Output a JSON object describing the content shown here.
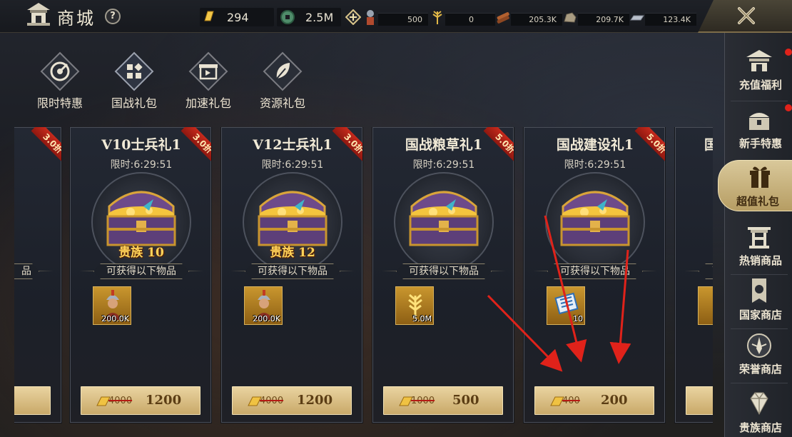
{
  "header": {
    "title": "商城",
    "help_label": "?",
    "gold": "294",
    "coins": "2.5M",
    "resources": [
      {
        "icon": "soldier-icon",
        "value": "500"
      },
      {
        "icon": "grain-icon",
        "value": "0"
      },
      {
        "icon": "wood-icon",
        "value": "205.3K"
      },
      {
        "icon": "stone-icon",
        "value": "209.7K"
      },
      {
        "icon": "iron-icon",
        "value": "123.4K"
      }
    ]
  },
  "categories": [
    {
      "label": "限时特惠"
    },
    {
      "label": "国战礼包"
    },
    {
      "label": "加速礼包"
    },
    {
      "label": "资源礼包"
    }
  ],
  "cards": [
    {
      "title": "V10士兵礼1",
      "discount": "3.0折",
      "timer": "限时:6:29:51",
      "nobility": "贵族 10",
      "obtain": "可获得以下物品",
      "item_icon": "soldier-icon",
      "item_qty": "200.0K",
      "old_price": "4000",
      "new_price": "1200"
    },
    {
      "title": "V12士兵礼1",
      "discount": "3.0折",
      "timer": "限时:6:29:51",
      "nobility": "贵族 12",
      "obtain": "可获得以下物品",
      "item_icon": "soldier-icon",
      "item_qty": "200.0K",
      "old_price": "4000",
      "new_price": "1200"
    },
    {
      "title": "国战粮草礼1",
      "discount": "5.0折",
      "timer": "限时:6:29:51",
      "nobility": "",
      "obtain": "可获得以下物品",
      "item_icon": "grain-icon",
      "item_qty": "5.0M",
      "old_price": "1000",
      "new_price": "500"
    },
    {
      "title": "国战建设礼1",
      "discount": "5.0折",
      "timer": "限时:6:29:51",
      "nobility": "",
      "obtain": "可获得以下物品",
      "item_icon": "scroll-icon",
      "item_qty": "10",
      "old_price": "400",
      "new_price": "200"
    }
  ],
  "partial_cards": {
    "left_title": "礼1",
    "left_discount": "3.0折",
    "left_obtain": "品",
    "right_title": "国",
    "right_obtain": "可"
  },
  "sidebar": {
    "items": [
      {
        "label": "充值福利"
      },
      {
        "label": "新手特惠"
      },
      {
        "label": "超值礼包"
      },
      {
        "label": "热销商品"
      },
      {
        "label": "国家商店"
      },
      {
        "label": "荣誉商店"
      },
      {
        "label": "贵族商店"
      }
    ],
    "active": "超值礼包"
  },
  "colors": {
    "accent_gold": "#c9a969",
    "discount_red": "#c62a1c",
    "annotation_red": "#e0221a"
  }
}
